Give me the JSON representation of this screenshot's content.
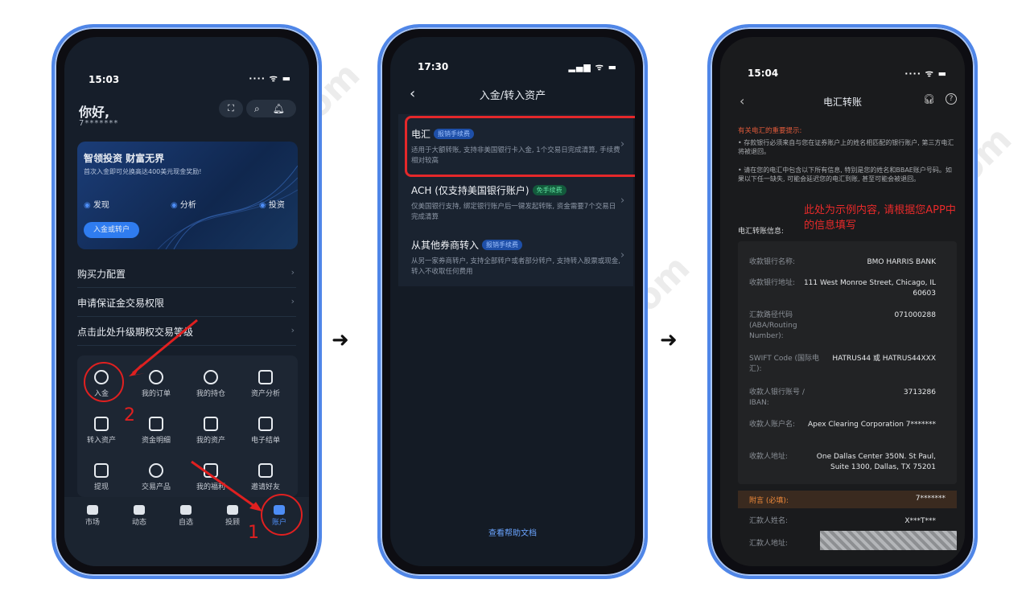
{
  "watermark": "ttshuoka.com",
  "phone1": {
    "time": "15:03",
    "signal": "···· ᯤ ▬",
    "greeting": "你好,",
    "account_masked": "7*******",
    "banner": {
      "title": "智领投资 财富无界",
      "subtitle": "首次入金即可兑换高达400美元现金奖励!",
      "links": [
        "发现",
        "分析",
        "投资"
      ],
      "button": "入金或转户"
    },
    "menu": [
      "购买力配置",
      "申请保证金交易权限",
      "点击此处升级期权交易等级"
    ],
    "grid": [
      "入金",
      "我的订单",
      "我的持仓",
      "资产分析",
      "转入资产",
      "资金明细",
      "我的资产",
      "电子结单",
      "提现",
      "交易产品",
      "我的福利",
      "邀请好友"
    ],
    "tabs": [
      "市场",
      "动态",
      "自选",
      "投顾",
      "账户"
    ],
    "annotations": [
      "1",
      "2"
    ]
  },
  "phone2": {
    "time": "17:30",
    "signal": "▂▄▆ ᯤ ▬",
    "back": "‹",
    "title": "入金/转入资产",
    "items": [
      {
        "title": "电汇",
        "badge": "报销手续费",
        "desc": "适用于大额转账, 支持非美国银行卡入金, 1个交易日完成清算, 手续费相对较高"
      },
      {
        "title": "ACH (仅支持美国银行账户)",
        "badge": "免手续费",
        "desc": "仅美国银行支持, 绑定银行账户后一键发起转账, 资金需要7个交易日完成清算"
      },
      {
        "title": "从其他券商转入",
        "badge": "报销手续费",
        "desc": "从另一家券商转户, 支持全部转户或者部分转户, 支持转入股票或现金, 转入不收取任何费用"
      }
    ],
    "help": "查看帮助文档"
  },
  "phone3": {
    "time": "15:04",
    "signal": "···· ᯤ ▬",
    "back": "‹",
    "title": "电汇转账",
    "notice_title": "有关电汇的重要提示:",
    "notices": [
      "• 存款银行必须来自与您在证券账户上的姓名相匹配的银行账户, 第三方电汇将被退回。",
      "• 请在您的电汇中包含以下所有信息, 特别是您的姓名和BBAE账户号码。如果以下任一缺失, 可能会延迟您的电汇到账, 甚至可能会被退回。"
    ],
    "section_label": "电汇转账信息:",
    "example_note": "此处为示例内容, 请根据您APP中的信息填写",
    "rows": [
      {
        "label": "收款银行名称:",
        "value": "BMO HARRIS BANK"
      },
      {
        "label": "收款银行地址:",
        "value": "111 West Monroe Street, Chicago, IL 60603"
      },
      {
        "label": "汇款路径代码 (ABA/Routing Number):",
        "value": "071000288"
      },
      {
        "label": "SWIFT Code (国际电汇):",
        "value": "HATRUS44 或 HATRUS44XXX"
      },
      {
        "label": "收款人银行账号 / IBAN:",
        "value": "3713286"
      },
      {
        "label": "收款人账户名:",
        "value": "Apex Clearing Corporation 7*******"
      },
      {
        "label": "收款人地址:",
        "value": "One Dallas Center 350N. St Paul, Suite 1300, Dallas, TX 75201"
      }
    ],
    "memo_label": "附言 (必填):",
    "memo_value": "7*******",
    "remitter_name_label": "汇款人姓名:",
    "remitter_name_value": "X***T***",
    "remitter_addr_label": "汇款人地址:"
  }
}
